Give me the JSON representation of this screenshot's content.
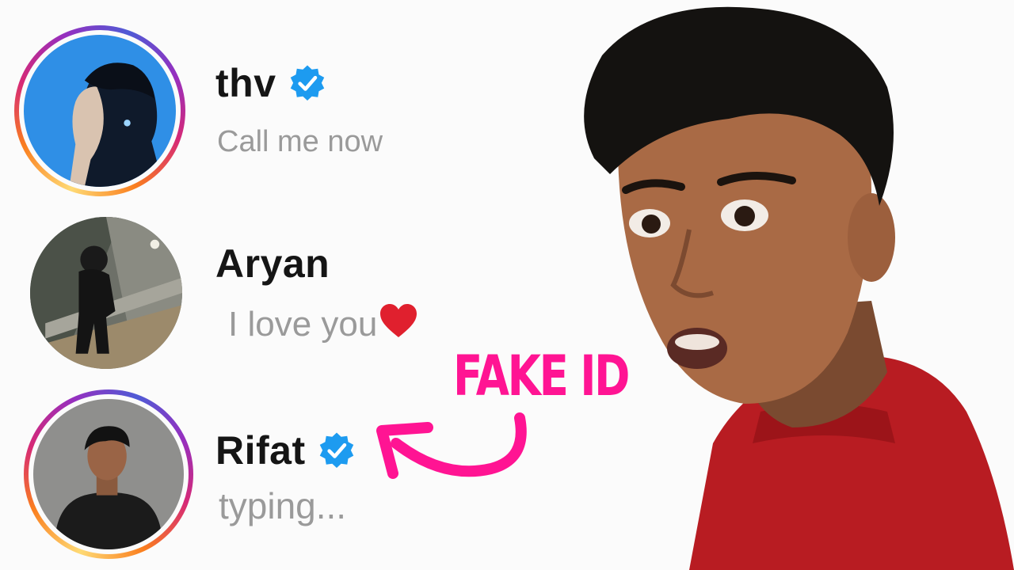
{
  "chats": [
    {
      "name": "thv",
      "preview": "Call me now",
      "verified": true,
      "story_ring": true,
      "avatar": "profile-photo"
    },
    {
      "name": "Aryan",
      "preview": "I love you",
      "verified": false,
      "story_ring": false,
      "avatar": "profile-photo",
      "emoji": "red-heart"
    },
    {
      "name": "Rifat",
      "preview": "typing...",
      "verified": true,
      "story_ring": true,
      "avatar": "profile-photo"
    }
  ],
  "annotation": {
    "label": "FAKE ID",
    "color": "#ff1493",
    "arrow_icon": "curved-arrow"
  },
  "colors": {
    "verified_badge": "#1d9bf0",
    "heart": "#e0202e",
    "name_text": "#151515",
    "preview_text": "#9a9a9a"
  }
}
